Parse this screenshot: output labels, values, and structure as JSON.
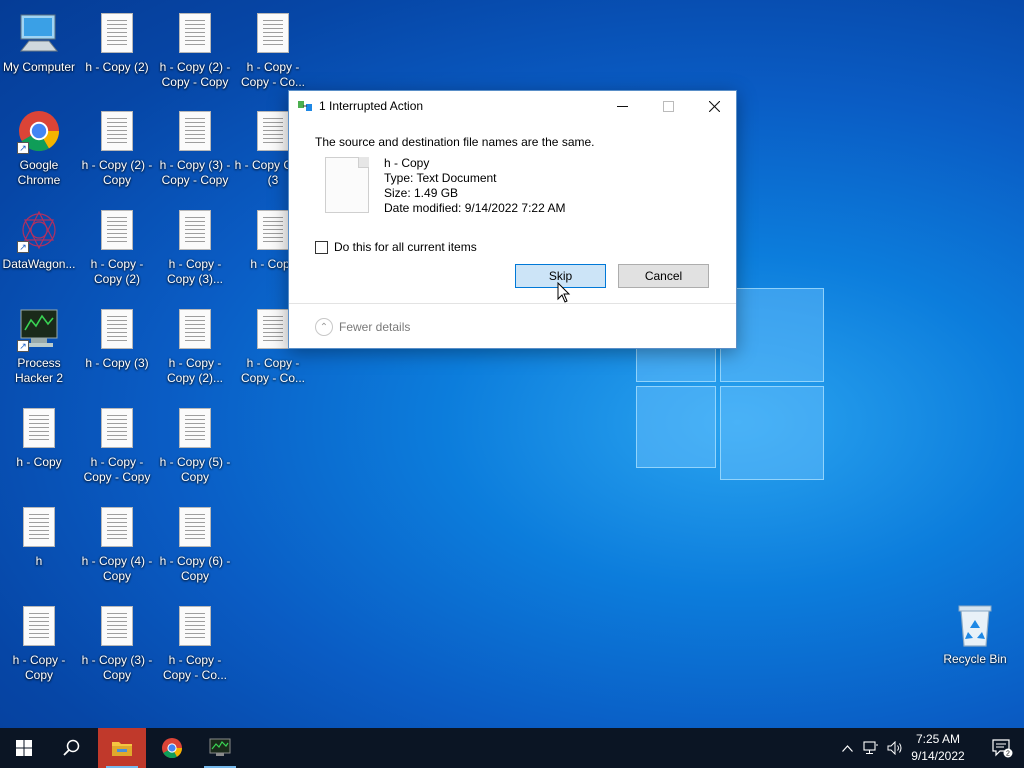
{
  "desktop": {
    "icons": [
      {
        "label": "My Computer",
        "kind": "computer-icon"
      },
      {
        "label": "h - Copy (2)",
        "kind": "document-icon"
      },
      {
        "label": "h - Copy (2) - Copy - Copy",
        "kind": "document-icon"
      },
      {
        "label": "h - Copy - Copy - Co...",
        "kind": "document-icon"
      },
      {
        "label": "Google Chrome",
        "kind": "chrome-icon"
      },
      {
        "label": "h - Copy (2) - Copy",
        "kind": "document-icon"
      },
      {
        "label": "h - Copy (3) - Copy - Copy",
        "kind": "document-icon"
      },
      {
        "label": "h - Copy Copy (3",
        "kind": "document-icon"
      },
      {
        "label": "DataWagon...",
        "kind": "datawagon-icon"
      },
      {
        "label": "h - Copy - Copy (2)",
        "kind": "document-icon"
      },
      {
        "label": "h - Copy - Copy (3)...",
        "kind": "document-icon"
      },
      {
        "label": "h - Copy",
        "kind": "document-icon"
      },
      {
        "label": "Process Hacker 2",
        "kind": "process-hacker-icon"
      },
      {
        "label": "h - Copy (3)",
        "kind": "document-icon"
      },
      {
        "label": "h - Copy - Copy (2)...",
        "kind": "document-icon"
      },
      {
        "label": "h - Copy - Copy - Co...",
        "kind": "document-icon"
      },
      {
        "label": "h - Copy",
        "kind": "document-icon"
      },
      {
        "label": "h - Copy - Copy - Copy",
        "kind": "document-icon"
      },
      {
        "label": "h - Copy (5) - Copy",
        "kind": "document-icon"
      },
      {
        "label": "h",
        "kind": "document-icon"
      },
      {
        "label": "h - Copy (4) - Copy",
        "kind": "document-icon"
      },
      {
        "label": "h - Copy (6) - Copy",
        "kind": "document-icon"
      },
      {
        "label": "h - Copy - Copy",
        "kind": "document-icon"
      },
      {
        "label": "h - Copy (3) - Copy",
        "kind": "document-icon"
      },
      {
        "label": "h - Copy - Copy - Co...",
        "kind": "document-icon"
      }
    ],
    "recycle_bin": {
      "label": "Recycle Bin"
    }
  },
  "dialog": {
    "title": "1 Interrupted Action",
    "message": "The source and destination file names are the same.",
    "file": {
      "name": "h - Copy",
      "type": "Type: Text Document",
      "size": "Size: 1.49 GB",
      "modified": "Date modified: 9/14/2022 7:22 AM"
    },
    "checkbox_label": "Do this for all current items",
    "checkbox_checked": false,
    "skip_label": "Skip",
    "cancel_label": "Cancel",
    "fewer_details_label": "Fewer details"
  },
  "taskbar": {
    "pinned": [
      "start-icon",
      "search-icon",
      "file-explorer-icon",
      "chrome-icon",
      "process-hacker-icon"
    ],
    "clock_time": "7:25 AM",
    "clock_date": "9/14/2022",
    "notification_count": "2"
  }
}
